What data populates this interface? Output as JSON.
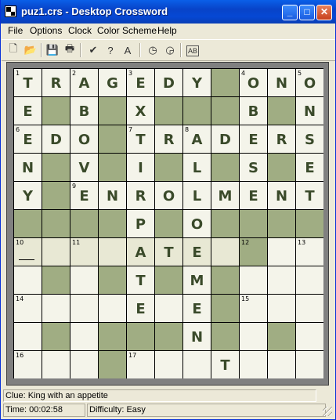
{
  "window": {
    "title": "puz1.crs - Desktop Crossword"
  },
  "menu": [
    "File",
    "Options",
    "Clock",
    "Color Scheme",
    "Help"
  ],
  "toolbar_icons": [
    "new-icon",
    "open-icon",
    "save-icon",
    "print-icon",
    "check-icon",
    "hint-icon",
    "reveal-icon",
    "clock-icon",
    "pause-icon",
    "word-icon"
  ],
  "colors": {
    "block": "#a0ad83",
    "cell": "#f4f4ea",
    "highlight": "#e8e8d4",
    "letter": "#3a4a2a"
  },
  "grid": {
    "rows": [
      "TRAGEDY#ONO",
      "E#B#X###B#N",
      "EDO#TRADERS",
      "N#V#I#L#S#E",
      "Y#ENROLMENT",
      "####P#O####",
      "....ATE.#..",
      ".#.#T#M#...",
      "....E.E#...",
      ".#.###N#.#.",
      "...#...T..."
    ],
    "numbers": [
      {
        "r": 0,
        "c": 0,
        "n": "1"
      },
      {
        "r": 0,
        "c": 2,
        "n": "2"
      },
      {
        "r": 0,
        "c": 4,
        "n": "3"
      },
      {
        "r": 0,
        "c": 8,
        "n": "4"
      },
      {
        "r": 0,
        "c": 10,
        "n": "5"
      },
      {
        "r": 2,
        "c": 0,
        "n": "6"
      },
      {
        "r": 2,
        "c": 4,
        "n": "7"
      },
      {
        "r": 2,
        "c": 6,
        "n": "8"
      },
      {
        "r": 4,
        "c": 2,
        "n": "9"
      },
      {
        "r": 6,
        "c": 0,
        "n": "10"
      },
      {
        "r": 6,
        "c": 2,
        "n": "11"
      },
      {
        "r": 6,
        "c": 8,
        "n": "12"
      },
      {
        "r": 6,
        "c": 10,
        "n": "13"
      },
      {
        "r": 8,
        "c": 0,
        "n": "14"
      },
      {
        "r": 8,
        "c": 8,
        "n": "15"
      },
      {
        "r": 10,
        "c": 0,
        "n": "16"
      },
      {
        "r": 10,
        "c": 4,
        "n": "17"
      }
    ],
    "highlight": [
      [
        6,
        0
      ],
      [
        6,
        1
      ],
      [
        6,
        2
      ],
      [
        6,
        3
      ],
      [
        6,
        4
      ],
      [
        6,
        5
      ],
      [
        6,
        6
      ],
      [
        6,
        7
      ]
    ],
    "cursor": [
      6,
      0
    ]
  },
  "status": {
    "clue": "Clue: King with an appetite",
    "time": "Time: 00:02:58",
    "difficulty": "Difficulty: Easy"
  }
}
